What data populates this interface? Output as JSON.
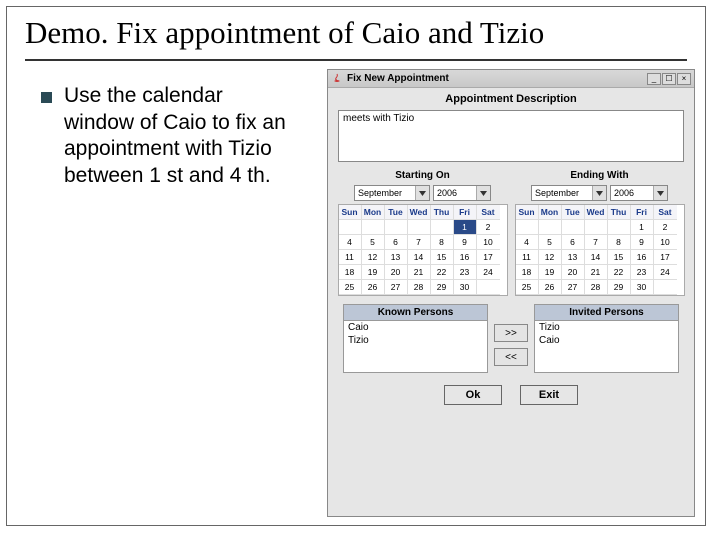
{
  "slide": {
    "title": "Demo. Fix appointment of Caio and Tizio",
    "bullet": "Use the calendar window of Caio to fix an appointment with Tizio between 1 st and 4 th."
  },
  "app": {
    "window_title": "Fix New Appointment",
    "desc_label": "Appointment Description",
    "desc_value": "meets with Tizio",
    "start_label": "Starting On",
    "end_label": "Ending With",
    "month": "September",
    "year": "2006",
    "dow": [
      "Sun",
      "Mon",
      "Tue",
      "Wed",
      "Thu",
      "Fri",
      "Sat"
    ],
    "cal_start": {
      "rows": [
        [
          "",
          "",
          "",
          "",
          "",
          "1",
          "2"
        ],
        [
          "4",
          "5",
          "6",
          "7",
          "8",
          "9",
          "10"
        ],
        [
          "11",
          "12",
          "13",
          "14",
          "15",
          "16",
          "17"
        ],
        [
          "18",
          "19",
          "20",
          "21",
          "22",
          "23",
          "24"
        ],
        [
          "25",
          "26",
          "27",
          "28",
          "29",
          "30",
          ""
        ]
      ],
      "selected": "1"
    },
    "cal_end": {
      "rows": [
        [
          "",
          "",
          "",
          "",
          "",
          "1",
          "2"
        ],
        [
          "4",
          "5",
          "6",
          "7",
          "8",
          "9",
          "10"
        ],
        [
          "11",
          "12",
          "13",
          "14",
          "15",
          "16",
          "17"
        ],
        [
          "18",
          "19",
          "20",
          "21",
          "22",
          "23",
          "24"
        ],
        [
          "25",
          "26",
          "27",
          "28",
          "29",
          "30",
          ""
        ]
      ]
    },
    "known_label": "Known Persons",
    "invited_label": "Invited Persons",
    "known": [
      "Caio",
      "Tizio"
    ],
    "invited": [
      "Tizio",
      "Caio"
    ],
    "xfer_right": ">>",
    "xfer_left": "<<",
    "ok": "Ok",
    "exit": "Exit"
  }
}
